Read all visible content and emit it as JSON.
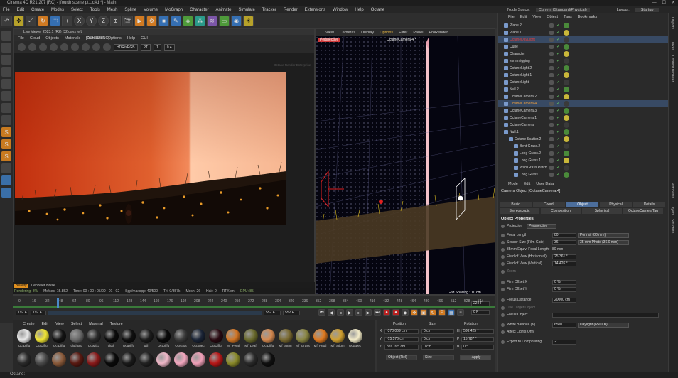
{
  "window": {
    "title": "Cinema 4D R21.207 [RC] - [fourth scene pt1.c4d *] - Main"
  },
  "menubar": [
    "File",
    "Edit",
    "Create",
    "Modes",
    "Select",
    "Tools",
    "Mesh",
    "Spline",
    "Volume",
    "MoGraph",
    "Character",
    "Animate",
    "Simulate",
    "Tracker",
    "Render",
    "Extensions",
    "Window",
    "Help",
    "Octane"
  ],
  "right_header": {
    "node_space_label": "Node Space:",
    "node_space_value": "Current (Standard/Physical)",
    "layout_label": "Layout:",
    "layout_value": "Startup"
  },
  "toolbar_icons": [
    "undo-icon",
    "move-icon",
    "scale-icon",
    "rotate-icon",
    "select-icon",
    "recent-icon",
    "x-axis-icon",
    "y-axis-icon",
    "z-axis-icon",
    "coord-system-icon",
    "clapboard-icon",
    "render-view-icon",
    "render-settings-icon",
    "cube-icon",
    "pen-icon",
    "subdivision-icon",
    "array-icon",
    "deformer-icon",
    "floor-icon",
    "camera-icon",
    "light-icon"
  ],
  "toolbar_axes": [
    "X",
    "Y",
    "Z"
  ],
  "left_tools": [
    "model-icon",
    "texture-icon",
    "points-icon",
    "edges-icon",
    "polygons-icon",
    "uv-icon",
    "axis-icon",
    "snap-icon",
    "octane-s-icon",
    "octane-s-icon-2",
    "octane-s-icon-3",
    "paint-icon",
    "layers-icon",
    "layers-icon-2"
  ],
  "live_viewer": {
    "title": "Live Viewer 2023.1 (R2) [32 days left]",
    "menu": [
      "File",
      "Cloud",
      "Objects",
      "Materials",
      "Compare",
      "Options",
      "Help",
      "GUI"
    ],
    "render_status": "[RENDERING]",
    "color_space": "HDR/sRGB",
    "mode": "PT",
    "value_a": "1",
    "value_b": "0.4",
    "watermark": "Octane Render Enterprise",
    "buffer_label": "Beauty",
    "render_info": "Denoiser Noise",
    "stats": {
      "rendering": "Rendering: 8%",
      "ms_sec": "Ms/sec: 15.852",
      "time": "Time: 00 : 00 : 05/00 : 01 : 02",
      "spp": "Spp/maxspp: 40/500",
      "tri": "Tri: 0/357k",
      "mesh": "Mesh: 26",
      "hair": "Hair: 0",
      "rtx": "RTX:on",
      "gpu": "GPU: 85"
    }
  },
  "viewport": {
    "menu": [
      "View",
      "Cameras",
      "Display",
      "Options",
      "Filter",
      "Panel",
      "ProRender"
    ],
    "camera_label": "OctaneCamera.4 *",
    "perspective_label": "Perspective",
    "grid_spacing": "Grid Spacing : 10 cm"
  },
  "timeline": {
    "ticks": [
      "0",
      "16",
      "32",
      "48",
      "64",
      "80",
      "96",
      "112",
      "128",
      "144",
      "160",
      "176",
      "192",
      "208",
      "224",
      "240",
      "256",
      "272",
      "288",
      "304",
      "320",
      "336",
      "352",
      "368",
      "384",
      "400",
      "416",
      "432",
      "448",
      "464",
      "480",
      "496",
      "512",
      "528",
      "544"
    ],
    "current_frame": "192 F",
    "start": "192 F",
    "end": "552 F",
    "end2": "552 F",
    "frame_display": "224 F",
    "frame_display2": "0 F"
  },
  "material_manager": {
    "menu": [
      "Create",
      "Edit",
      "View",
      "Select",
      "Material",
      "Texture"
    ],
    "materials": [
      {
        "name": "OctDiffu",
        "color": "#e8e8e8"
      },
      {
        "name": "OctDiffu",
        "color": "#f2e634"
      },
      {
        "name": "OctDiffu",
        "color": "#141414"
      },
      {
        "name": "clothgro",
        "color": "#6a6a6a"
      },
      {
        "name": "OctMix1",
        "color": "#2a2a2a"
      },
      {
        "name": "cloth",
        "color": "#0c0c0c"
      },
      {
        "name": "OctDiffu",
        "color": "#101010"
      },
      {
        "name": "tail",
        "color": "#1c1c1c"
      },
      {
        "name": "OctDiffu",
        "color": "#0a0a0a"
      },
      {
        "name": "OctGlos",
        "color": "#3a3a3a"
      },
      {
        "name": "OctSpec",
        "color": "#1a2436"
      },
      {
        "name": "OctDiffu",
        "color": "#2a0a12"
      },
      {
        "name": "Mf_Petal",
        "color": "#d27524"
      },
      {
        "name": "Mf_Leaf",
        "color": "#6a6a2c"
      },
      {
        "name": "OctDiffu",
        "color": "#d68a50"
      },
      {
        "name": "Mf_Stem",
        "color": "#7a6a30"
      },
      {
        "name": "Mf_Grass",
        "color": "#8a8642"
      },
      {
        "name": "Mf_Petal",
        "color": "#e07a20"
      },
      {
        "name": "Mf_Stigm",
        "color": "#d0a030"
      },
      {
        "name": "OctSpec",
        "color": "#f4ecc8"
      }
    ],
    "materials_row2": [
      "#2a2a2a",
      "#4a4a4a",
      "#8a5a3a",
      "#5a1a12",
      "#8a1a1a",
      "#0a0a0a",
      "#1a1a1a",
      "#222",
      "#f0b8c8",
      "#f4a8c0",
      "#f0a0b8",
      "#b81818",
      "#8a8a2a",
      "#2a2a2a",
      "#101010"
    ]
  },
  "coord_manager": {
    "headers": [
      "Position",
      "Size",
      "Rotation"
    ],
    "rows": [
      {
        "axis": "X",
        "pos": "-370.069 cm",
        "size": "0 cm",
        "rot_label": "H",
        "rot": "536.425 °"
      },
      {
        "axis": "Y",
        "pos": "-15.576 cm",
        "size": "0 cm",
        "rot_label": "P",
        "rot": "15.787 °"
      },
      {
        "axis": "Z",
        "pos": "876.095 cm",
        "size": "0 cm",
        "rot_label": "B",
        "rot": "0 °"
      }
    ],
    "object_dropdown": "Object (Rel)",
    "size_dropdown": "Size",
    "apply": "Apply"
  },
  "object_manager": {
    "menu": [
      "File",
      "Edit",
      "View",
      "Object",
      "Tags",
      "Bookmarks"
    ],
    "objects": [
      {
        "name": "Plane.2",
        "indent": 0,
        "color": "#cfcfcf"
      },
      {
        "name": "Plane.1",
        "indent": 0,
        "color": "#cfcfcf"
      },
      {
        "name": "OctaneDayLight",
        "indent": 0,
        "color": "#e04040",
        "selected": true
      },
      {
        "name": "Cube",
        "indent": 0,
        "color": "#cfcfcf"
      },
      {
        "name": "Character",
        "indent": 0,
        "color": "#cfcfcf"
      },
      {
        "name": "kommrigging",
        "indent": 0,
        "color": "#cfcfcf"
      },
      {
        "name": "OctaneLight.2",
        "indent": 0,
        "color": "#cfcfcf"
      },
      {
        "name": "OctaneLight.1",
        "indent": 0,
        "color": "#cfcfcf"
      },
      {
        "name": "OctaneLight",
        "indent": 0,
        "color": "#cfcfcf"
      },
      {
        "name": "Null.2",
        "indent": 0,
        "color": "#cfcfcf"
      },
      {
        "name": "OctaneCamera.2",
        "indent": 0,
        "color": "#cfcfcf"
      },
      {
        "name": "OctaneCamera.4",
        "indent": 0,
        "color": "#f0a040",
        "selected": true
      },
      {
        "name": "OctaneCamera.3",
        "indent": 0,
        "color": "#cfcfcf"
      },
      {
        "name": "OctaneCamera.1",
        "indent": 0,
        "color": "#cfcfcf"
      },
      {
        "name": "OctaneCamera",
        "indent": 0,
        "color": "#cfcfcf"
      },
      {
        "name": "Null.1",
        "indent": 0,
        "color": "#cfcfcf"
      },
      {
        "name": "Octane Scatter.2",
        "indent": 1,
        "color": "#cfcfcf"
      },
      {
        "name": "Bent Grass.2",
        "indent": 2,
        "color": "#cfcfcf"
      },
      {
        "name": "Long Grass.2",
        "indent": 2,
        "color": "#cfcfcf"
      },
      {
        "name": "Long Grass.1",
        "indent": 2,
        "color": "#cfcfcf"
      },
      {
        "name": "Wild Grass Patch",
        "indent": 2,
        "color": "#cfcfcf"
      },
      {
        "name": "Long Grass",
        "indent": 2,
        "color": "#cfcfcf"
      }
    ]
  },
  "side_tabs": [
    "Objects",
    "Takes",
    "Content Browser",
    "Attributes",
    "Layers",
    "Structure"
  ],
  "attribute_manager": {
    "menu": [
      "Mode",
      "Edit",
      "User Data"
    ],
    "title": "Camera Object [OctaneCamera.4]",
    "tabs_row1": [
      "Basic",
      "Coord.",
      "Object",
      "Physical",
      "Details"
    ],
    "tabs_row2": [
      "Stereoscopic",
      "Composition",
      "Spherical",
      "OctaneCameraTag"
    ],
    "active_tab": "Object",
    "section": "Object Properties",
    "props": [
      {
        "label": "Projection",
        "value": "Perspective",
        "type": "dropdown"
      },
      {
        "label": "Focal Length",
        "value": "80",
        "extra": "Portrait (80 mm)"
      },
      {
        "label": "Sensor Size (Film Gate)",
        "value": "36",
        "extra": "35 mm Photo (36.0 mm)"
      },
      {
        "label": "35mm Equiv. Focal Length:",
        "value": "80 mm",
        "type": "static"
      },
      {
        "label": "Field of View (Horizontal)",
        "value": "25.361 °"
      },
      {
        "label": "Field of View (Vertical)",
        "value": "14.426 °"
      },
      {
        "label": "Zoom",
        "value": "",
        "dim": true
      },
      {
        "label": "Film Offset X",
        "value": "0 %"
      },
      {
        "label": "Film Offset Y",
        "value": "0 %"
      },
      {
        "label": "Focus Distance",
        "value": "20000 cm"
      },
      {
        "label": "Use Target Object",
        "value": "",
        "dim": true
      },
      {
        "label": "Focus Object",
        "value": ""
      },
      {
        "label": "White Balance (K)",
        "value": "6500",
        "extra": "Daylight (6500 K)"
      },
      {
        "label": "Affect Lights Only",
        "value": ""
      },
      {
        "label": "Export to Compositing",
        "value": "✓"
      }
    ]
  },
  "statusbar": {
    "text": "Octane:"
  }
}
